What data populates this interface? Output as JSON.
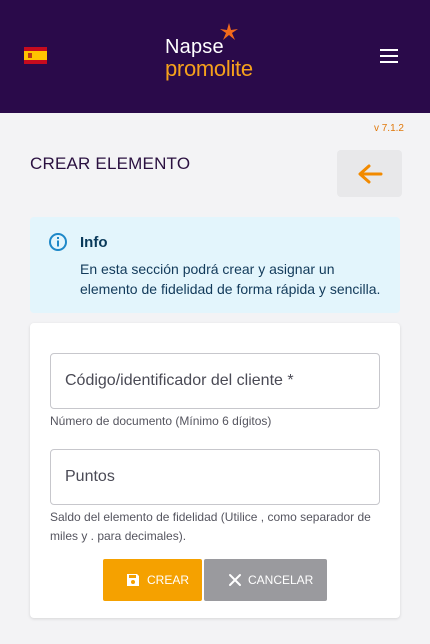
{
  "header": {
    "language_icon": "spain-flag-icon",
    "logo_line1": "Napse",
    "logo_line2": "promolite",
    "menu_icon": "hamburger-menu-icon",
    "bg_color": "#2a0a4a",
    "accent_color": "#f5a11c"
  },
  "version": "v 7.1.2",
  "page": {
    "title": "CREAR ELEMENTO",
    "back_icon": "arrow-left-icon"
  },
  "info": {
    "icon": "info-icon",
    "title": "Info",
    "body": "En esta sección podrá crear y asignar un elemento de fidelidad de forma rápida y sencilla."
  },
  "form": {
    "code_field": {
      "placeholder": "Código/identificador del cliente *",
      "value": "",
      "hint": "Número de documento (Mínimo 6 dígitos)"
    },
    "points_field": {
      "placeholder": "Puntos",
      "value": "",
      "hint": "Saldo del elemento de fidelidad (Utilice , como separador de miles y . para decimales)."
    },
    "create_button": {
      "label": "CREAR",
      "icon": "save-icon"
    },
    "cancel_button": {
      "label": "CANCELAR",
      "icon": "close-icon"
    }
  }
}
